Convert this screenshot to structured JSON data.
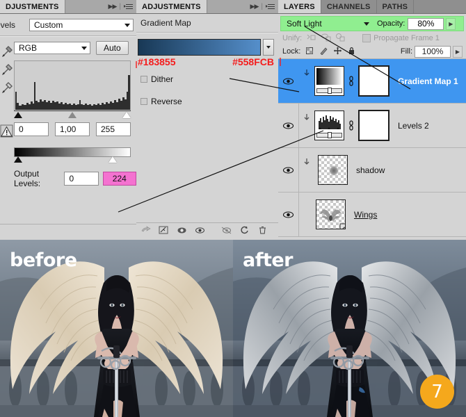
{
  "levels_panel": {
    "tab_label": "ADJUSTMENTS",
    "tab_truncated": "DJUSTMENTS",
    "title": "Levels",
    "title_truncated": "evels",
    "preset": "Custom",
    "channel": "RGB",
    "auto_button": "Auto",
    "input_shadow": "0",
    "input_midtone": "1,00",
    "input_highlight": "255",
    "output_label": "Output Levels:",
    "output_black": "0",
    "output_white": "224",
    "icons": {
      "collapse": "double-arrow-icon",
      "menu": "panel-menu-icon",
      "eyedropper_black": "eyedropper-black-icon",
      "eyedropper_gray": "eyedropper-gray-icon",
      "eyedropper_white": "eyedropper-white-icon",
      "warning": "clipping-warning-icon"
    }
  },
  "gradient_map_panel": {
    "tab_label": "ADJUSTMENTS",
    "title": "Gradient Map",
    "title_truncated": "Gradient Map",
    "gradient_start_hex": "#183855",
    "gradient_end_hex": "#558FCB",
    "dither_label": "Dither",
    "reverse_label": "Reverse",
    "dither_checked": false,
    "reverse_checked": false,
    "annotation_color": "#F41C1C"
  },
  "layers_panel": {
    "tabs": [
      {
        "label": "LAYERS",
        "active": true
      },
      {
        "label": "CHANNELS",
        "active": false
      },
      {
        "label": "PATHS",
        "active": false
      }
    ],
    "blend_mode": "Soft Light",
    "opacity_label": "Opacity:",
    "opacity_value": "80%",
    "highlight_color": "#90EE90",
    "unify_label": "Unify:",
    "propagate_label": "Propagate Frame 1",
    "propagate_checked": true,
    "lock_label": "Lock:",
    "fill_label": "Fill:",
    "fill_value": "100%",
    "selection_color": "#3F96F0",
    "layers": [
      {
        "name": "Gradient Map 1",
        "selected": true,
        "visible": true,
        "type": "adjustment-gradient",
        "has_mask": true,
        "clipped": true,
        "underline": false
      },
      {
        "name": "Levels 2",
        "selected": false,
        "visible": true,
        "type": "adjustment-levels",
        "has_mask": true,
        "clipped": true,
        "underline": false
      },
      {
        "name": "shadow",
        "selected": false,
        "visible": true,
        "type": "pixel",
        "has_mask": false,
        "clipped": true,
        "underline": false
      },
      {
        "name": "Wings",
        "selected": false,
        "visible": true,
        "type": "pixel",
        "has_mask": false,
        "clipped": false,
        "underline": true
      }
    ]
  },
  "comparison": {
    "before_label": "before",
    "after_label": "after",
    "step_badge": "7",
    "badge_color": "#F5A81C"
  }
}
